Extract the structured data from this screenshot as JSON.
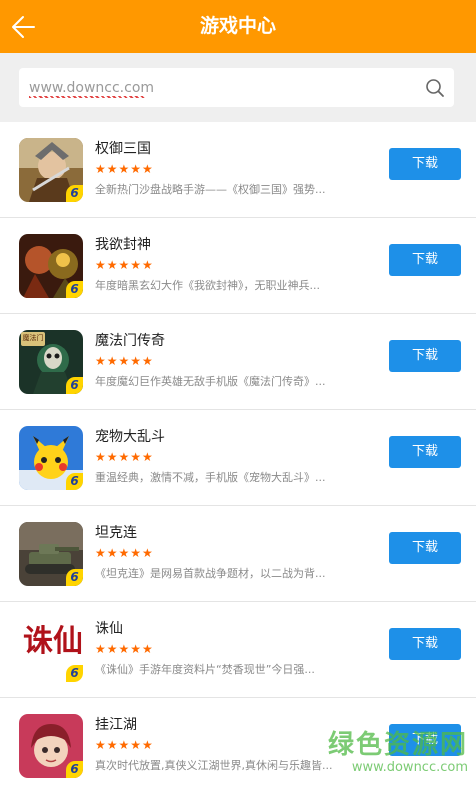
{
  "header": {
    "title": "游戏中心"
  },
  "search": {
    "placeholder": "www.downcc.com"
  },
  "games": [
    {
      "name": "权御三国",
      "rating": 5,
      "stars": "★★★★★",
      "desc": "全新热门沙盘战略手游——《权御三国》强势...",
      "download_label": "下载"
    },
    {
      "name": "我欲封神",
      "rating": 5,
      "stars": "★★★★★",
      "desc": "年度暗黑玄幻大作《我欲封神》，无职业神兵...",
      "download_label": "下载"
    },
    {
      "name": "魔法门传奇",
      "rating": 5,
      "stars": "★★★★★",
      "desc": "年度魔幻巨作英雄无敌手机版《魔法门传奇》...",
      "download_label": "下载"
    },
    {
      "name": "宠物大乱斗",
      "rating": 5,
      "stars": "★★★★★",
      "desc": "重温经典，激情不减，手机版《宠物大乱斗》...",
      "download_label": "下载"
    },
    {
      "name": "坦克连",
      "rating": 5,
      "stars": "★★★★★",
      "desc": "《坦克连》是网易首款战争题材，以二战为背...",
      "download_label": "下载"
    },
    {
      "name": "诛仙",
      "rating": 5,
      "stars": "★★★★★",
      "desc": "《诛仙》手游年度资料片“焚香现世”今日强...",
      "download_label": "下载"
    },
    {
      "name": "挂江湖",
      "rating": 5,
      "stars": "★★★★★",
      "desc": "真次时代放置,真侠义江湖世界,真休闲与乐趣皆...",
      "download_label": "下载"
    }
  ],
  "icon_badge": "6",
  "icon_labels": {
    "mofamen": "魔法门",
    "zhuxian": "诛仙"
  },
  "watermark": {
    "line1": "绿色资源网",
    "line2": "www.downcc.com"
  },
  "colors": {
    "header": "#FF9800",
    "button": "#1E90E8",
    "star": "#FF6A00"
  }
}
